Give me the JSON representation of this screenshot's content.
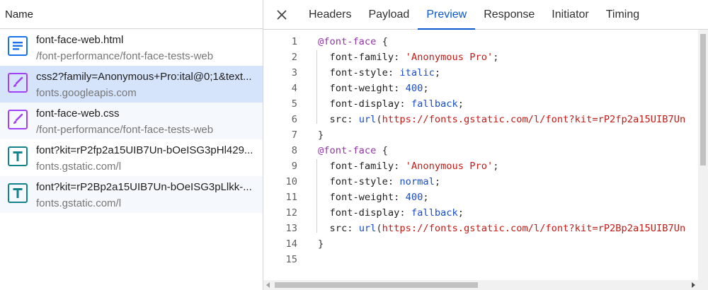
{
  "left_header": {
    "label": "Name"
  },
  "requests": [
    {
      "name": "font-face-web.html",
      "path": "/font-performance/font-face-tests-web",
      "icon": "document-icon"
    },
    {
      "name": "css2?family=Anonymous+Pro:ital@0;1&text...",
      "path": "fonts.googleapis.com",
      "icon": "stylesheet-icon"
    },
    {
      "name": "font-face-web.css",
      "path": "/font-performance/font-face-tests-web",
      "icon": "stylesheet-icon"
    },
    {
      "name": "font?kit=rP2fp2a15UIB7Un-bOeISG3pHl429...",
      "path": "fonts.gstatic.com/l",
      "icon": "font-icon"
    },
    {
      "name": "font?kit=rP2Bp2a15UIB7Un-bOeISG3pLlkk-...",
      "path": "fonts.gstatic.com/l",
      "icon": "font-icon"
    }
  ],
  "tabs": [
    "Headers",
    "Payload",
    "Preview",
    "Response",
    "Initiator",
    "Timing"
  ],
  "active_tab": "Preview",
  "code_lines": [
    {
      "n": "1",
      "t": [
        [
          "at",
          "@font-face"
        ],
        [
          "punct",
          " {"
        ]
      ]
    },
    {
      "n": "2",
      "t": [
        [
          "prop",
          "  font-family"
        ],
        [
          "punct",
          ": "
        ],
        [
          "str",
          "'Anonymous Pro'"
        ],
        [
          "punct",
          ";"
        ]
      ]
    },
    {
      "n": "3",
      "t": [
        [
          "prop",
          "  font-style"
        ],
        [
          "punct",
          ": "
        ],
        [
          "kw",
          "italic"
        ],
        [
          "punct",
          ";"
        ]
      ]
    },
    {
      "n": "4",
      "t": [
        [
          "prop",
          "  font-weight"
        ],
        [
          "punct",
          ": "
        ],
        [
          "num",
          "400"
        ],
        [
          "punct",
          ";"
        ]
      ]
    },
    {
      "n": "5",
      "t": [
        [
          "prop",
          "  font-display"
        ],
        [
          "punct",
          ": "
        ],
        [
          "kw",
          "fallback"
        ],
        [
          "punct",
          ";"
        ]
      ]
    },
    {
      "n": "6",
      "t": [
        [
          "prop",
          "  src"
        ],
        [
          "punct",
          ": "
        ],
        [
          "kw",
          "url"
        ],
        [
          "punct",
          "("
        ],
        [
          "url",
          "https://fonts.gstatic.com/l/font?kit=rP2fp2a15UIB7Un"
        ]
      ]
    },
    {
      "n": "7",
      "t": [
        [
          "punct",
          "}"
        ]
      ]
    },
    {
      "n": "8",
      "t": [
        [
          "at",
          "@font-face"
        ],
        [
          "punct",
          " {"
        ]
      ]
    },
    {
      "n": "9",
      "t": [
        [
          "prop",
          "  font-family"
        ],
        [
          "punct",
          ": "
        ],
        [
          "str",
          "'Anonymous Pro'"
        ],
        [
          "punct",
          ";"
        ]
      ]
    },
    {
      "n": "10",
      "t": [
        [
          "prop",
          "  font-style"
        ],
        [
          "punct",
          ": "
        ],
        [
          "kw",
          "normal"
        ],
        [
          "punct",
          ";"
        ]
      ]
    },
    {
      "n": "11",
      "t": [
        [
          "prop",
          "  font-weight"
        ],
        [
          "punct",
          ": "
        ],
        [
          "num",
          "400"
        ],
        [
          "punct",
          ";"
        ]
      ]
    },
    {
      "n": "12",
      "t": [
        [
          "prop",
          "  font-display"
        ],
        [
          "punct",
          ": "
        ],
        [
          "kw",
          "fallback"
        ],
        [
          "punct",
          ";"
        ]
      ]
    },
    {
      "n": "13",
      "t": [
        [
          "prop",
          "  src"
        ],
        [
          "punct",
          ": "
        ],
        [
          "kw",
          "url"
        ],
        [
          "punct",
          "("
        ],
        [
          "url",
          "https://fonts.gstatic.com/l/font?kit=rP2Bp2a15UIB7Un"
        ]
      ]
    },
    {
      "n": "14",
      "t": [
        [
          "punct",
          "}"
        ]
      ]
    },
    {
      "n": "15",
      "t": []
    }
  ],
  "colors": {
    "accent": "#0b57d0",
    "selected_row": "#d5e3fb",
    "doc_icon": "#1a73e8",
    "css_icon": "#a142f4",
    "font_icon": "#12828c"
  }
}
